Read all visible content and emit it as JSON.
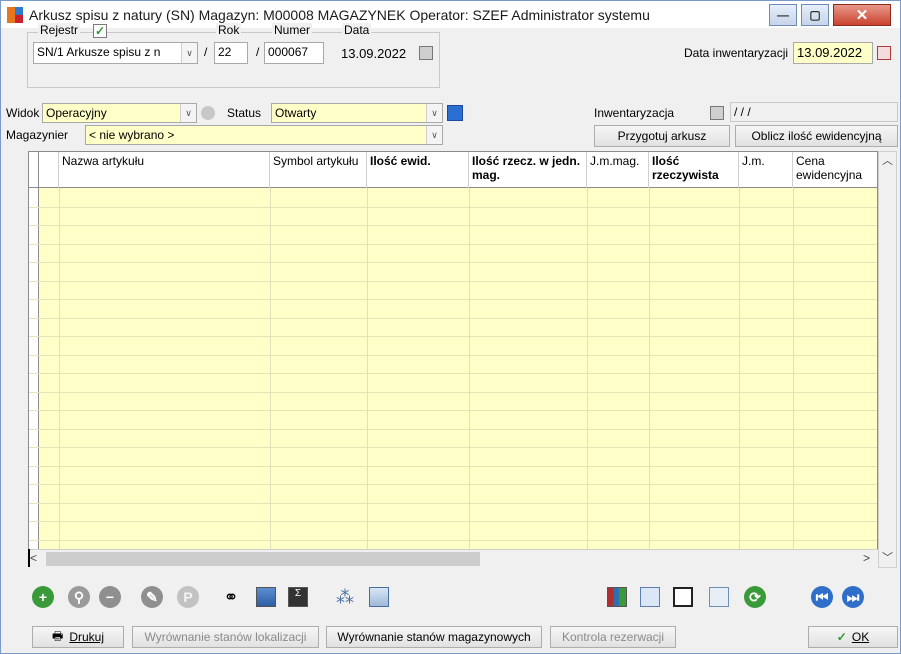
{
  "window": {
    "title": "Arkusz spisu z natury (SN)  Magazyn: M00008 MAGAZYNEK  Operator: SZEF Administrator systemu",
    "minimize": "—",
    "maximize": "▢",
    "close": "✕"
  },
  "header": {
    "rejestr_label": "Rejestr",
    "rok_label": "Rok",
    "numer_label": "Numer",
    "data_label": "Data",
    "rejestr_value": "SN/1 Arkusze spisu z n",
    "slash1": "/",
    "rok_value": "22",
    "slash2": "/",
    "numer_value": "000067",
    "data_value": "13.09.2022",
    "data_inw_label": "Data inwentaryzacji",
    "data_inw_value": "13.09.2022"
  },
  "filters": {
    "widok_label": "Widok",
    "widok_value": "Operacyjny",
    "status_label": "Status",
    "status_value": "Otwarty",
    "inwentaryzacja_label": "Inwentaryzacja",
    "inwentaryzacja_value": "/ / /",
    "magazynier_label": "Magazynier",
    "magazynier_value": "< nie wybrano >",
    "przygotuj_button": "Przygotuj arkusz",
    "oblicz_button": "Oblicz ilość ewidencyjną"
  },
  "grid": {
    "columns": [
      {
        "label": "Nazwa artykułu",
        "bold": false
      },
      {
        "label": "Symbol artykułu",
        "bold": false
      },
      {
        "label": "Ilość ewid.",
        "bold": true
      },
      {
        "label": "Ilość rzecz. w jedn. mag.",
        "bold": true
      },
      {
        "label": "J.m.mag.",
        "bold": false
      },
      {
        "label": "Ilość rzeczywista",
        "bold": true
      },
      {
        "label": "J.m.",
        "bold": false
      },
      {
        "label": "Cena ewidencyjna",
        "bold": false
      }
    ],
    "row_count": 20
  },
  "toolbar": {
    "icons": [
      "add-icon",
      "view-icon",
      "remove-icon",
      "edit-icon",
      "p-icon",
      "binoculars-icon",
      "calc-table-icon",
      "sum-icon",
      "group-icon",
      "export-icon",
      "chart-icon",
      "document-icon",
      "save-icon",
      "copy-icon",
      "refresh-icon",
      "prev-icon",
      "next-icon"
    ]
  },
  "footer": {
    "drukuj_button": "Drukuj",
    "wyr_lok_button": "Wyrównanie stanów lokalizacji",
    "wyr_mag_button": "Wyrównanie stanów magazynowych",
    "kontrola_button": "Kontrola rezerwacji",
    "ok_button": "OK"
  }
}
